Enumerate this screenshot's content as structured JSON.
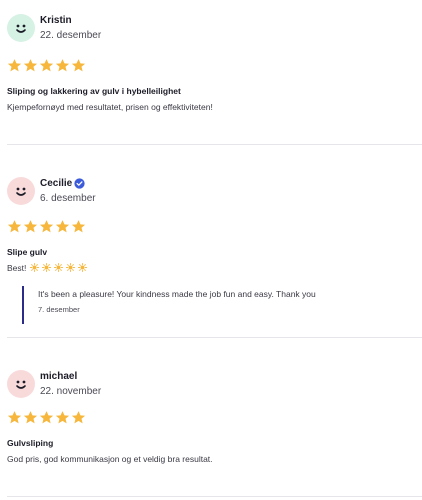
{
  "colors": {
    "star": "#f6b73c",
    "avatar_green": "#d6f2e4",
    "avatar_pink": "#f9dada",
    "verified": "#3b5bdb",
    "reply_bar": "#2b2b8a",
    "sun": "#f6b73c"
  },
  "reviews": [
    {
      "name": "Kristin",
      "date": "22. desember",
      "rating": 5,
      "title": "Sliping og lakkering av gulv i hybelleilighet",
      "text": "Kjempefornøyd med resultatet, prisen og effektiviteten!",
      "avatar_icon": "smiley-face-icon"
    },
    {
      "name": "Cecilie",
      "verified_icon": "verified-badge-icon",
      "date": "6. desember",
      "rating": 5,
      "title": "Slipe gulv",
      "text": "Best!",
      "emoji": "sun-icon",
      "emoji_count": 5,
      "reply": {
        "text": "It's been a pleasure! Your kindness made the job fun and easy. Thank you",
        "date": "7. desember"
      },
      "avatar_icon": "smiley-face-icon"
    },
    {
      "name": "michael",
      "date": "22. november",
      "rating": 5,
      "title": "Gulvsliping",
      "text": "God pris, god kommunikasjon og et veldig bra resultat.",
      "avatar_icon": "smiley-face-icon"
    }
  ]
}
